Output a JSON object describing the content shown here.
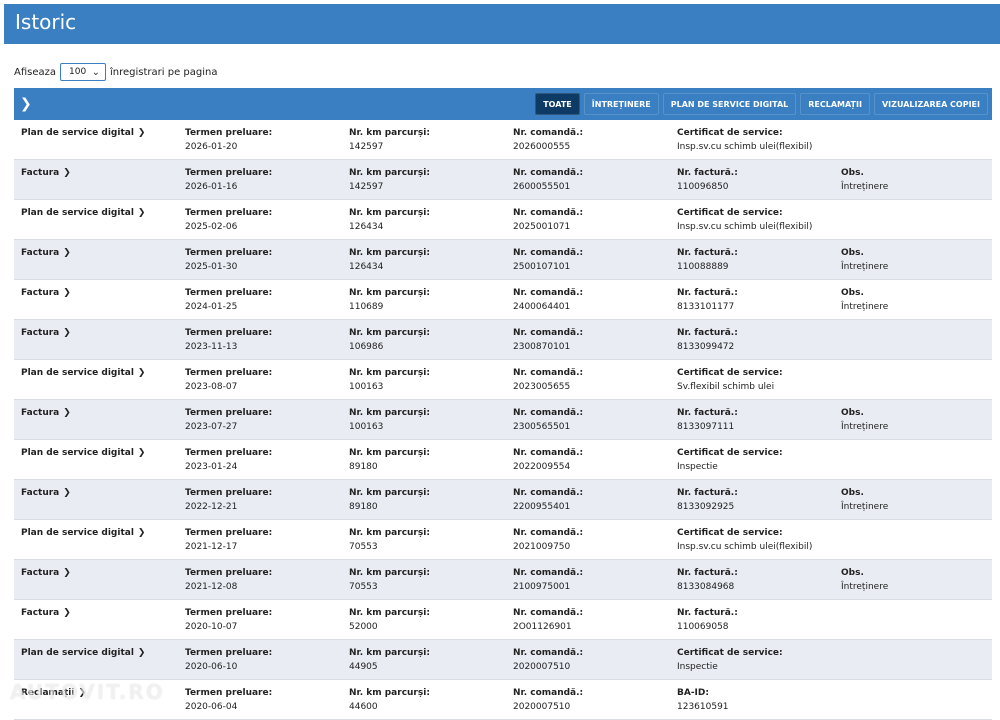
{
  "header": {
    "title": "Istoric"
  },
  "page_size": {
    "prefix": "Afiseaza",
    "value": "100",
    "suffix": "înregistrari pe pagina"
  },
  "filters": [
    {
      "label": "TOATE",
      "active": true
    },
    {
      "label": "ÎNTREȚINERE",
      "active": false
    },
    {
      "label": "PLAN DE SERVICE DIGITAL",
      "active": false
    },
    {
      "label": "RECLAMAȚII",
      "active": false
    },
    {
      "label": "VIZUALIZAREA COPIEI",
      "active": false
    }
  ],
  "records": [
    {
      "type": "Plan de service digital",
      "date_label": "Termen preluare:",
      "date": "2026-01-20",
      "km_label": "Nr. km parcurși:",
      "km": "142597",
      "order_label": "Nr. comandă.:",
      "order": "2026000555",
      "c4_label": "Certificat de service:",
      "c4": "Insp.sv.cu schimb ulei(flexibil)",
      "c5_label": "",
      "c5": ""
    },
    {
      "type": "Factura",
      "date_label": "Termen preluare:",
      "date": "2026-01-16",
      "km_label": "Nr. km parcurși:",
      "km": "142597",
      "order_label": "Nr. comandă.:",
      "order": "2600055501",
      "c4_label": "Nr. factură.:",
      "c4": "110096850",
      "c5_label": "Obs.",
      "c5": "Întreținere"
    },
    {
      "type": "Plan de service digital",
      "date_label": "Termen preluare:",
      "date": "2025-02-06",
      "km_label": "Nr. km parcurși:",
      "km": "126434",
      "order_label": "Nr. comandă.:",
      "order": "2025001071",
      "c4_label": "Certificat de service:",
      "c4": "Insp.sv.cu schimb ulei(flexibil)",
      "c5_label": "",
      "c5": ""
    },
    {
      "type": "Factura",
      "date_label": "Termen preluare:",
      "date": "2025-01-30",
      "km_label": "Nr. km parcurși:",
      "km": "126434",
      "order_label": "Nr. comandă.:",
      "order": "2500107101",
      "c4_label": "Nr. factură.:",
      "c4": "110088889",
      "c5_label": "Obs.",
      "c5": "Întreținere"
    },
    {
      "type": "Factura",
      "date_label": "Termen preluare:",
      "date": "2024-01-25",
      "km_label": "Nr. km parcurși:",
      "km": "110689",
      "order_label": "Nr. comandă.:",
      "order": "2400064401",
      "c4_label": "Nr. factură.:",
      "c4": "8133101177",
      "c5_label": "Obs.",
      "c5": "Întreținere"
    },
    {
      "type": "Factura",
      "date_label": "Termen preluare:",
      "date": "2023-11-13",
      "km_label": "Nr. km parcurși:",
      "km": "106986",
      "order_label": "Nr. comandă.:",
      "order": "2300870101",
      "c4_label": "Nr. factură.:",
      "c4": "8133099472",
      "c5_label": "",
      "c5": ""
    },
    {
      "type": "Plan de service digital",
      "date_label": "Termen preluare:",
      "date": "2023-08-07",
      "km_label": "Nr. km parcurși:",
      "km": "100163",
      "order_label": "Nr. comandă.:",
      "order": "2023005655",
      "c4_label": "Certificat de service:",
      "c4": "Sv.flexibil schimb ulei",
      "c5_label": "",
      "c5": ""
    },
    {
      "type": "Factura",
      "date_label": "Termen preluare:",
      "date": "2023-07-27",
      "km_label": "Nr. km parcurși:",
      "km": "100163",
      "order_label": "Nr. comandă.:",
      "order": "2300565501",
      "c4_label": "Nr. factură.:",
      "c4": "8133097111",
      "c5_label": "Obs.",
      "c5": "Întreținere"
    },
    {
      "type": "Plan de service digital",
      "date_label": "Termen preluare:",
      "date": "2023-01-24",
      "km_label": "Nr. km parcurși:",
      "km": "89180",
      "order_label": "Nr. comandă.:",
      "order": "2022009554",
      "c4_label": "Certificat de service:",
      "c4": "Inspectie",
      "c5_label": "",
      "c5": ""
    },
    {
      "type": "Factura",
      "date_label": "Termen preluare:",
      "date": "2022-12-21",
      "km_label": "Nr. km parcurși:",
      "km": "89180",
      "order_label": "Nr. comandă.:",
      "order": "2200955401",
      "c4_label": "Nr. factură.:",
      "c4": "8133092925",
      "c5_label": "Obs.",
      "c5": "Întreținere"
    },
    {
      "type": "Plan de service digital",
      "date_label": "Termen preluare:",
      "date": "2021-12-17",
      "km_label": "Nr. km parcurși:",
      "km": "70553",
      "order_label": "Nr. comandă.:",
      "order": "2021009750",
      "c4_label": "Certificat de service:",
      "c4": "Insp.sv.cu schimb ulei(flexibil)",
      "c5_label": "",
      "c5": ""
    },
    {
      "type": "Factura",
      "date_label": "Termen preluare:",
      "date": "2021-12-08",
      "km_label": "Nr. km parcurși:",
      "km": "70553",
      "order_label": "Nr. comandă.:",
      "order": "2100975001",
      "c4_label": "Nr. factură.:",
      "c4": "8133084968",
      "c5_label": "Obs.",
      "c5": "Întreținere"
    },
    {
      "type": "Factura",
      "date_label": "Termen preluare:",
      "date": "2020-10-07",
      "km_label": "Nr. km parcurși:",
      "km": "52000",
      "order_label": "Nr. comandă.:",
      "order": "2O01126901",
      "c4_label": "Nr. factură.:",
      "c4": "110069058",
      "c5_label": "",
      "c5": ""
    },
    {
      "type": "Plan de service digital",
      "date_label": "Termen preluare:",
      "date": "2020-06-10",
      "km_label": "Nr. km parcurși:",
      "km": "44905",
      "order_label": "Nr. comandă.:",
      "order": "2020007510",
      "c4_label": "Certificat de service:",
      "c4": "Inspectie",
      "c5_label": "",
      "c5": ""
    },
    {
      "type": "Reclamații",
      "date_label": "Termen preluare:",
      "date": "2020-06-04",
      "km_label": "Nr. km parcurși:",
      "km": "44600",
      "order_label": "Nr. comandă.:",
      "order": "2020007510",
      "c4_label": "BA-ID:",
      "c4": "123610591",
      "c5_label": "",
      "c5": ""
    }
  ],
  "watermark": "AUTOVIT.RO",
  "colors": {
    "primary": "#3a7fc1",
    "active_filter": "#0d3b66",
    "row_alt": "#e9ecf3"
  }
}
